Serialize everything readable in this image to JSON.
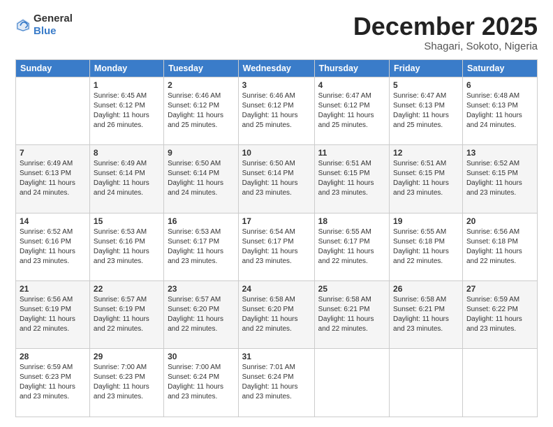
{
  "header": {
    "logo": {
      "general": "General",
      "blue": "Blue"
    },
    "title": "December 2025",
    "subtitle": "Shagari, Sokoto, Nigeria"
  },
  "weekdays": [
    "Sunday",
    "Monday",
    "Tuesday",
    "Wednesday",
    "Thursday",
    "Friday",
    "Saturday"
  ],
  "weeks": [
    [
      {
        "day": "",
        "sunrise": "",
        "sunset": "",
        "daylight": ""
      },
      {
        "day": "1",
        "sunrise": "Sunrise: 6:45 AM",
        "sunset": "Sunset: 6:12 PM",
        "daylight": "Daylight: 11 hours and 26 minutes."
      },
      {
        "day": "2",
        "sunrise": "Sunrise: 6:46 AM",
        "sunset": "Sunset: 6:12 PM",
        "daylight": "Daylight: 11 hours and 25 minutes."
      },
      {
        "day": "3",
        "sunrise": "Sunrise: 6:46 AM",
        "sunset": "Sunset: 6:12 PM",
        "daylight": "Daylight: 11 hours and 25 minutes."
      },
      {
        "day": "4",
        "sunrise": "Sunrise: 6:47 AM",
        "sunset": "Sunset: 6:12 PM",
        "daylight": "Daylight: 11 hours and 25 minutes."
      },
      {
        "day": "5",
        "sunrise": "Sunrise: 6:47 AM",
        "sunset": "Sunset: 6:13 PM",
        "daylight": "Daylight: 11 hours and 25 minutes."
      },
      {
        "day": "6",
        "sunrise": "Sunrise: 6:48 AM",
        "sunset": "Sunset: 6:13 PM",
        "daylight": "Daylight: 11 hours and 24 minutes."
      }
    ],
    [
      {
        "day": "7",
        "sunrise": "Sunrise: 6:49 AM",
        "sunset": "Sunset: 6:13 PM",
        "daylight": "Daylight: 11 hours and 24 minutes."
      },
      {
        "day": "8",
        "sunrise": "Sunrise: 6:49 AM",
        "sunset": "Sunset: 6:14 PM",
        "daylight": "Daylight: 11 hours and 24 minutes."
      },
      {
        "day": "9",
        "sunrise": "Sunrise: 6:50 AM",
        "sunset": "Sunset: 6:14 PM",
        "daylight": "Daylight: 11 hours and 24 minutes."
      },
      {
        "day": "10",
        "sunrise": "Sunrise: 6:50 AM",
        "sunset": "Sunset: 6:14 PM",
        "daylight": "Daylight: 11 hours and 23 minutes."
      },
      {
        "day": "11",
        "sunrise": "Sunrise: 6:51 AM",
        "sunset": "Sunset: 6:15 PM",
        "daylight": "Daylight: 11 hours and 23 minutes."
      },
      {
        "day": "12",
        "sunrise": "Sunrise: 6:51 AM",
        "sunset": "Sunset: 6:15 PM",
        "daylight": "Daylight: 11 hours and 23 minutes."
      },
      {
        "day": "13",
        "sunrise": "Sunrise: 6:52 AM",
        "sunset": "Sunset: 6:15 PM",
        "daylight": "Daylight: 11 hours and 23 minutes."
      }
    ],
    [
      {
        "day": "14",
        "sunrise": "Sunrise: 6:52 AM",
        "sunset": "Sunset: 6:16 PM",
        "daylight": "Daylight: 11 hours and 23 minutes."
      },
      {
        "day": "15",
        "sunrise": "Sunrise: 6:53 AM",
        "sunset": "Sunset: 6:16 PM",
        "daylight": "Daylight: 11 hours and 23 minutes."
      },
      {
        "day": "16",
        "sunrise": "Sunrise: 6:53 AM",
        "sunset": "Sunset: 6:17 PM",
        "daylight": "Daylight: 11 hours and 23 minutes."
      },
      {
        "day": "17",
        "sunrise": "Sunrise: 6:54 AM",
        "sunset": "Sunset: 6:17 PM",
        "daylight": "Daylight: 11 hours and 23 minutes."
      },
      {
        "day": "18",
        "sunrise": "Sunrise: 6:55 AM",
        "sunset": "Sunset: 6:17 PM",
        "daylight": "Daylight: 11 hours and 22 minutes."
      },
      {
        "day": "19",
        "sunrise": "Sunrise: 6:55 AM",
        "sunset": "Sunset: 6:18 PM",
        "daylight": "Daylight: 11 hours and 22 minutes."
      },
      {
        "day": "20",
        "sunrise": "Sunrise: 6:56 AM",
        "sunset": "Sunset: 6:18 PM",
        "daylight": "Daylight: 11 hours and 22 minutes."
      }
    ],
    [
      {
        "day": "21",
        "sunrise": "Sunrise: 6:56 AM",
        "sunset": "Sunset: 6:19 PM",
        "daylight": "Daylight: 11 hours and 22 minutes."
      },
      {
        "day": "22",
        "sunrise": "Sunrise: 6:57 AM",
        "sunset": "Sunset: 6:19 PM",
        "daylight": "Daylight: 11 hours and 22 minutes."
      },
      {
        "day": "23",
        "sunrise": "Sunrise: 6:57 AM",
        "sunset": "Sunset: 6:20 PM",
        "daylight": "Daylight: 11 hours and 22 minutes."
      },
      {
        "day": "24",
        "sunrise": "Sunrise: 6:58 AM",
        "sunset": "Sunset: 6:20 PM",
        "daylight": "Daylight: 11 hours and 22 minutes."
      },
      {
        "day": "25",
        "sunrise": "Sunrise: 6:58 AM",
        "sunset": "Sunset: 6:21 PM",
        "daylight": "Daylight: 11 hours and 22 minutes."
      },
      {
        "day": "26",
        "sunrise": "Sunrise: 6:58 AM",
        "sunset": "Sunset: 6:21 PM",
        "daylight": "Daylight: 11 hours and 23 minutes."
      },
      {
        "day": "27",
        "sunrise": "Sunrise: 6:59 AM",
        "sunset": "Sunset: 6:22 PM",
        "daylight": "Daylight: 11 hours and 23 minutes."
      }
    ],
    [
      {
        "day": "28",
        "sunrise": "Sunrise: 6:59 AM",
        "sunset": "Sunset: 6:23 PM",
        "daylight": "Daylight: 11 hours and 23 minutes."
      },
      {
        "day": "29",
        "sunrise": "Sunrise: 7:00 AM",
        "sunset": "Sunset: 6:23 PM",
        "daylight": "Daylight: 11 hours and 23 minutes."
      },
      {
        "day": "30",
        "sunrise": "Sunrise: 7:00 AM",
        "sunset": "Sunset: 6:24 PM",
        "daylight": "Daylight: 11 hours and 23 minutes."
      },
      {
        "day": "31",
        "sunrise": "Sunrise: 7:01 AM",
        "sunset": "Sunset: 6:24 PM",
        "daylight": "Daylight: 11 hours and 23 minutes."
      },
      {
        "day": "",
        "sunrise": "",
        "sunset": "",
        "daylight": ""
      },
      {
        "day": "",
        "sunrise": "",
        "sunset": "",
        "daylight": ""
      },
      {
        "day": "",
        "sunrise": "",
        "sunset": "",
        "daylight": ""
      }
    ]
  ]
}
